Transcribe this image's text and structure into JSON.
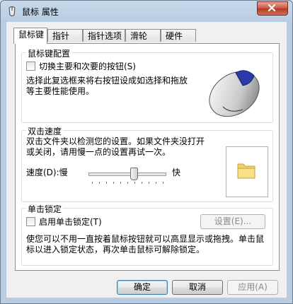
{
  "window": {
    "title": "鼠标 属性"
  },
  "tabs": [
    {
      "label": "鼠标键",
      "active": true
    },
    {
      "label": "指针"
    },
    {
      "label": "指针选项"
    },
    {
      "label": "滑轮"
    },
    {
      "label": "硬件"
    }
  ],
  "button_config": {
    "group_label": "鼠标键配置",
    "switch_checkbox_label": "切换主要和次要的按钮(S)",
    "switch_checked": false,
    "description": "选择此复选框来将右按钮设成如选择和拖放等主要性能使用。"
  },
  "double_click": {
    "group_label": "双击速度",
    "description": "双击文件夹以检测您的设置。如果文件夹没打开或关闭，请用慢一点的设置再试一次。",
    "speed_label": "速度(D):",
    "slow_label": "慢",
    "fast_label": "快",
    "slider_value_fraction": 0.6,
    "tick_count": 11
  },
  "click_lock": {
    "group_label": "单击锁定",
    "checkbox_label": "启用单击锁定(T)",
    "checked": false,
    "settings_label": "设置(E)...",
    "description": "使您可以不用一直按着鼠标按钮就可以高显显示或拖拽。单击鼠标以进入锁定状态，再次单击鼠标可解除锁定。"
  },
  "footer": {
    "ok_label": "确定",
    "cancel_label": "取消",
    "apply_label": "应用(A)"
  },
  "colors": {
    "title_bar": "#b9cde2",
    "close_button": "#c9543f",
    "group_border": "#d5dfe5"
  }
}
